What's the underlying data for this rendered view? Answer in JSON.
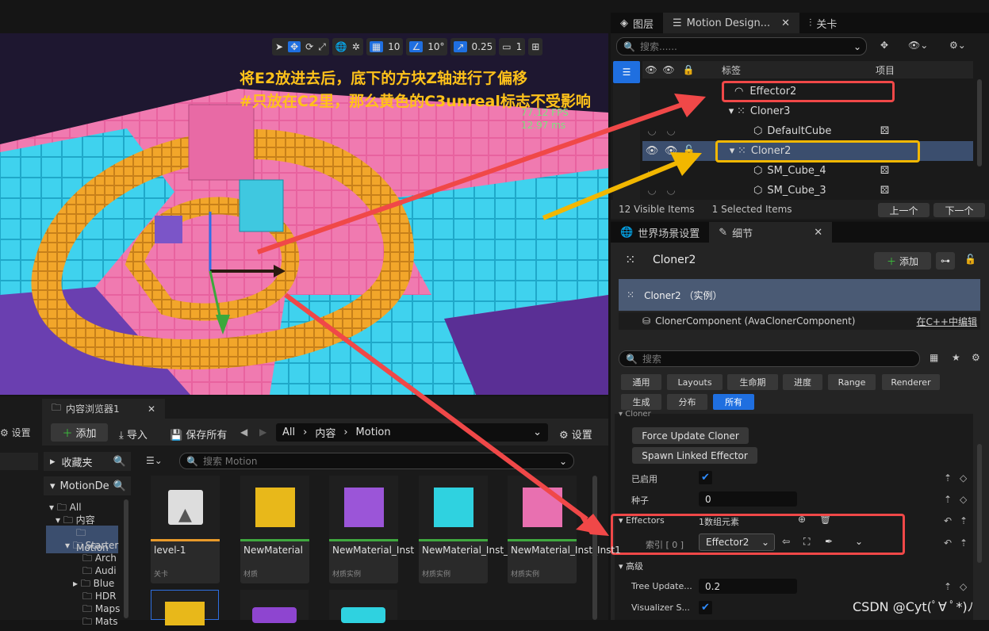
{
  "viewport": {
    "toolbar": {
      "grid_snap": "10",
      "rotation_snap": "10°",
      "scale_snap": "0.25",
      "camera_speed": "1"
    },
    "annotation_line1": "将E2放进去后，底下的方块Z轴进行了偏移",
    "annotation_line2": "#只放在C2里，那么黄色的C3unreal标志不受影响",
    "fps": "77.12 FPS",
    "frame_time": "12.97 ms"
  },
  "outliner": {
    "tabs": [
      {
        "label": "图层"
      },
      {
        "label": "Motion Design..."
      },
      {
        "label": "关卡"
      }
    ],
    "search_placeholder": "搜索......",
    "col_label": "标签",
    "col_item": "项目",
    "rows": [
      {
        "label": "Effector2"
      },
      {
        "label": "Cloner3"
      },
      {
        "label": "DefaultCube"
      },
      {
        "label": "Cloner2"
      },
      {
        "label": "SM_Cube_4"
      },
      {
        "label": "SM_Cube_3"
      }
    ],
    "visible_items": "12  Visible Items",
    "selected_items": "1  Selected Items",
    "prev": "上一个",
    "next": "下一个"
  },
  "details": {
    "tabs": [
      {
        "label": "世界场景设置"
      },
      {
        "label": "细节"
      }
    ],
    "object_name": "Cloner2",
    "add_label": "添加",
    "instance_label": "Cloner2 （实例）",
    "component_label": "ClonerComponent (AvaClonerComponent)",
    "edit_cpp": "在C++中编辑",
    "search_placeholder": "搜索",
    "filters_row1": [
      "通用",
      "Layouts",
      "生命期",
      "进度",
      "Range",
      "Renderer"
    ],
    "filters_row2": [
      "生成",
      "分布",
      "所有"
    ],
    "section_cloner": "Cloner",
    "force_update": "Force Update Cloner",
    "spawn_linked": "Spawn Linked Effector",
    "enabled_label": "已启用",
    "seed_label": "种子",
    "seed_value": "0",
    "effectors_label": "Effectors",
    "effectors_count": "1数组元素",
    "index_label": "索引 [ 0 ]",
    "index_value": "Effector2",
    "advanced_label": "高级",
    "tree_update_label": "Tree Update...",
    "tree_update_value": "0.2",
    "visualizer_label": "Visualizer S..."
  },
  "content_browser": {
    "left_settings": "设置",
    "tab_label": "内容浏览器1",
    "add_label": "添加",
    "import_label": "导入",
    "save_all_label": "保存所有",
    "breadcrumb": [
      "All",
      "内容",
      "Motion"
    ],
    "settings_label": "设置",
    "favorites": "收藏夹",
    "project_root": "MotionDe",
    "search_placeholder": "搜索 Motion",
    "tree": [
      "All",
      "内容",
      "Motion",
      "Starter",
      "Arch",
      "Audi",
      "Blue",
      "HDR",
      "Maps",
      "Mats"
    ],
    "assets": [
      {
        "name": "level-1",
        "type": "关卡"
      },
      {
        "name": "NewMaterial",
        "type": "材质"
      },
      {
        "name": "NewMaterial_Inst",
        "type": "材质实例"
      },
      {
        "name": "NewMaterial_Inst_Inst",
        "type": "材质实例"
      },
      {
        "name": "NewMaterial_Inst_Inst1",
        "type": "材质实例"
      }
    ]
  },
  "watermark": "CSDN @Cyt(ﾟ∀ ﾟ*)ﾉ"
}
